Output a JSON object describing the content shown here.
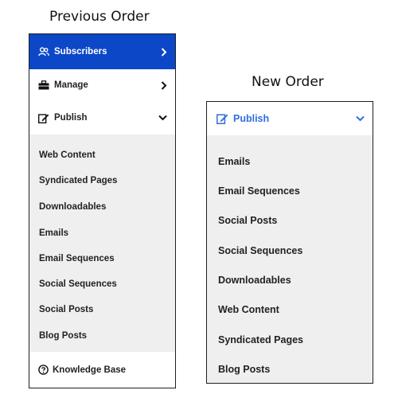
{
  "previous": {
    "heading": "Previous Order",
    "menu": {
      "subscribers": "Subscribers",
      "manage": "Manage",
      "publish": "Publish"
    },
    "publish_items": [
      "Web Content",
      "Syndicated Pages",
      "Downloadables",
      "Emails",
      "Email Sequences",
      "Social Sequences",
      "Social Posts",
      "Blog Posts"
    ],
    "footer": "Knowledge Base"
  },
  "new": {
    "heading": "New Order",
    "publish": "Publish",
    "publish_items": [
      "Emails",
      "Email Sequences",
      "Social Posts",
      "Social Sequences",
      "Downloadables",
      "Web Content",
      "Syndicated Pages",
      "Blog Posts"
    ]
  },
  "colors": {
    "active_bg": "#0c47c8",
    "active_text": "#ffffff",
    "accent_blue": "#2f6fe0",
    "submenu_bg": "#efefef"
  },
  "icons": {
    "subscribers": "users-icon",
    "manage": "briefcase-icon",
    "publish": "edit-document-icon",
    "footer": "help-circle-icon",
    "expand": "chevron-right-icon",
    "collapse": "chevron-down-icon"
  }
}
